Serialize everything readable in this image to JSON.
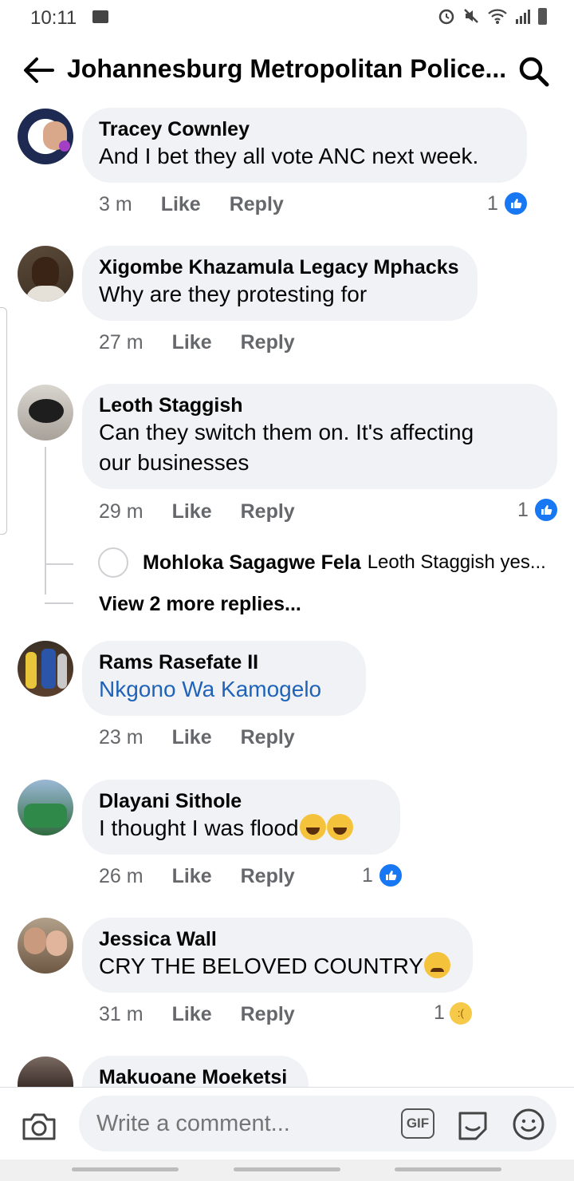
{
  "status": {
    "time": "10:11"
  },
  "header": {
    "title": "Johannesburg Metropolitan Police..."
  },
  "comments": [
    {
      "author": "Tracey Cownley",
      "text": "And I bet they all vote ANC next week.",
      "time": "3 m",
      "like": "Like",
      "reply": "Reply",
      "reactions": "1",
      "reaction_type": "like"
    },
    {
      "author": "Xigombe Khazamula Legacy Mphacks",
      "text": "Why are they protesting for",
      "time": "27 m",
      "like": "Like",
      "reply": "Reply"
    },
    {
      "author": "Leoth Staggish",
      "text_line1": "Can they switch them on. It's affecting",
      "text_line2": "our businesses",
      "time": "29 m",
      "like": "Like",
      "reply": "Reply",
      "reactions": "1",
      "reaction_type": "like"
    },
    {
      "author": "Rams Rasefate II",
      "text": "Nkgono Wa Kamogelo",
      "time": "23 m",
      "like": "Like",
      "reply": "Reply"
    },
    {
      "author": "Dlayani Sithole",
      "text": "I thought I was flood",
      "time": "26 m",
      "like": "Like",
      "reply": "Reply",
      "reactions": "1",
      "reaction_type": "like"
    },
    {
      "author": "Jessica Wall",
      "text": "CRY THE BELOVED COUNTRY",
      "time": "31 m",
      "like": "Like",
      "reply": "Reply",
      "reactions": "1",
      "reaction_type": "sad"
    },
    {
      "author": "Makuoane Moeketsi"
    }
  ],
  "thread": {
    "reply_author": "Mohloka Sagagwe Fela",
    "reply_preview": "Leoth Staggish yes...",
    "more_replies": "View 2 more replies..."
  },
  "composer": {
    "placeholder": "Write a comment...",
    "gif_label": "GIF"
  },
  "colors": {
    "link": "#1f63b8",
    "like_blue": "#1877f2",
    "bubble": "#f0f2f5",
    "meta": "#65676b"
  }
}
